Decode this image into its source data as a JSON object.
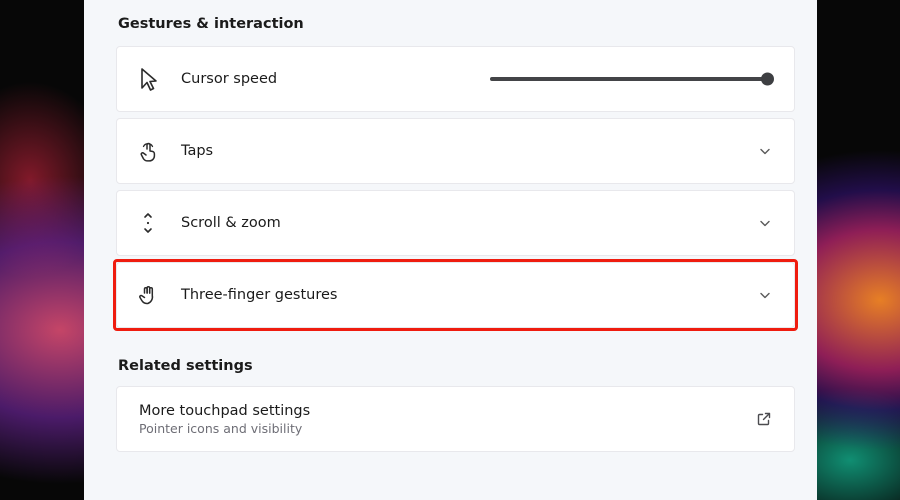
{
  "section_gestures": {
    "heading": "Gestures & interaction",
    "cursor_speed": {
      "label": "Cursor speed",
      "value": 100,
      "min": 0,
      "max": 100
    },
    "taps": {
      "label": "Taps"
    },
    "scroll_zoom": {
      "label": "Scroll & zoom"
    },
    "three_finger": {
      "label": "Three-finger gestures"
    }
  },
  "section_related": {
    "heading": "Related settings",
    "more_touchpad": {
      "label": "More touchpad settings",
      "sub": "Pointer icons and visibility"
    }
  }
}
